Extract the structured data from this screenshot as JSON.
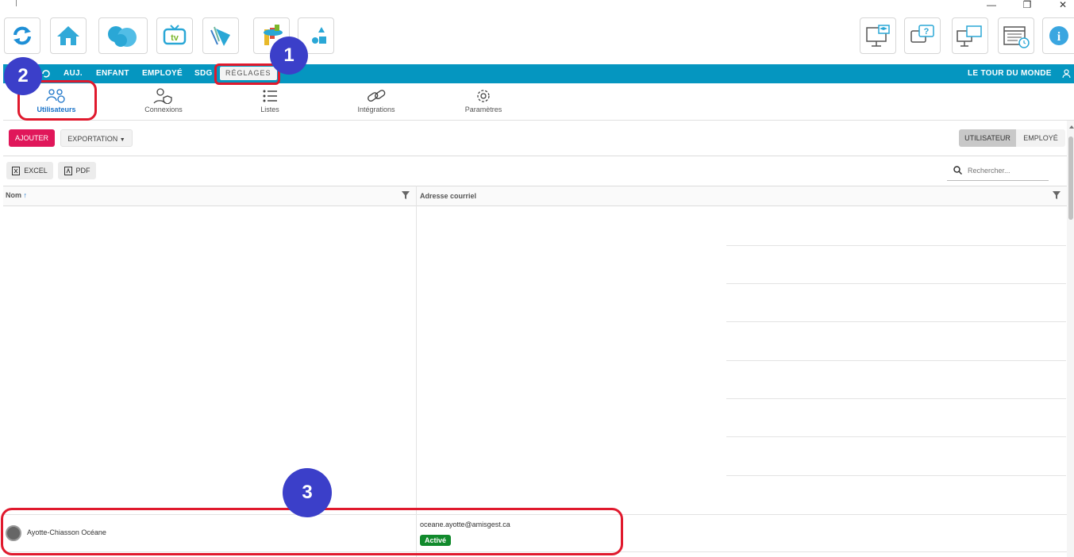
{
  "window": {
    "minimize": "—",
    "restore": "❐",
    "close": "✕"
  },
  "toolbar": {
    "left": [
      {
        "name": "refresh-icon"
      },
      {
        "name": "home-icon"
      },
      {
        "name": "cloud-icon"
      },
      {
        "name": "tv-icon",
        "label": "tv"
      },
      {
        "name": "leaf-icon"
      },
      {
        "name": "kids-icon"
      },
      {
        "name": "shapes-icon"
      }
    ],
    "right": [
      {
        "name": "training-icon"
      },
      {
        "name": "help-chat-icon"
      },
      {
        "name": "sync-screens-icon"
      },
      {
        "name": "calendar-icon"
      },
      {
        "name": "info-icon",
        "label": "i"
      }
    ]
  },
  "nav": {
    "items": [
      "AUJ.",
      "ENFANT",
      "EMPLOYÉ",
      "SDG"
    ],
    "active": "RÉGLAGES",
    "org_name": "LE TOUR DU MONDE"
  },
  "subtabs": [
    "Utilisateurs",
    "Connexions",
    "Listes",
    "Intégrations",
    "Paramètres"
  ],
  "actions": {
    "add": "AJOUTER",
    "export": "EXPORTATION",
    "toggle_user": "UTILISATEUR",
    "toggle_employee": "EMPLOYÉ",
    "excel": "EXCEL",
    "pdf": "PDF",
    "search_placeholder": "Rechercher..."
  },
  "table": {
    "columns": [
      "Nom",
      "Adresse courriel"
    ],
    "rows": [
      {
        "name": "Ayotte-Chiasson Océane",
        "email": "oceane.ayotte@amisgest.ca",
        "status": "Activé"
      }
    ]
  },
  "callouts": [
    "1",
    "2",
    "3"
  ],
  "colors": {
    "nav": "#0596c0",
    "accent_red": "#e0192d",
    "add_button": "#e0175a",
    "callout": "#3b3fc9",
    "status_green": "#118a2c"
  }
}
